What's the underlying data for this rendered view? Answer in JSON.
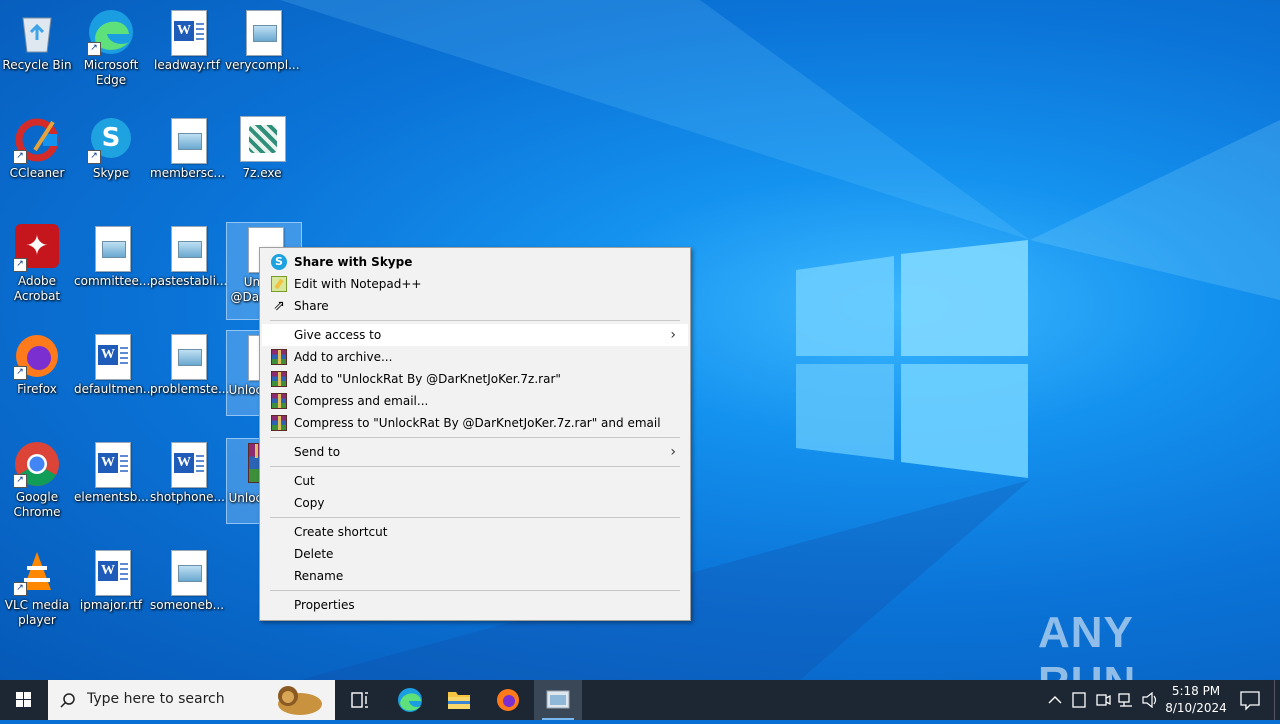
{
  "desktop_icons": [
    {
      "label": "Recycle Bin"
    },
    {
      "label": "Microsoft Edge"
    },
    {
      "label": "leadway.rtf"
    },
    {
      "label": "verycompl..."
    },
    {
      "label": "CCleaner"
    },
    {
      "label": "Skype"
    },
    {
      "label": "membersc..."
    },
    {
      "label": "7z.exe"
    },
    {
      "label": "Adobe Acrobat"
    },
    {
      "label": "committee..."
    },
    {
      "label": "pastestabli..."
    },
    {
      "label": "Unlock @Dark er.7"
    },
    {
      "label": "Firefox"
    },
    {
      "label": "defaultmen..."
    },
    {
      "label": "problemste..."
    },
    {
      "label": "Unloc @Dar"
    },
    {
      "label": "Google Chrome"
    },
    {
      "label": "elementsb..."
    },
    {
      "label": "shotphone..."
    },
    {
      "label": "Unloc @Dar"
    },
    {
      "label": "VLC media player"
    },
    {
      "label": "ipmajor.rtf"
    },
    {
      "label": "someoneb..."
    }
  ],
  "context_menu": {
    "share_skype": "Share with Skype",
    "edit_npp": "Edit with Notepad++",
    "share": "Share",
    "give_access": "Give access to",
    "add_archive": "Add to archive...",
    "add_to_rar": "Add to \"UnlockRat By @DarKnetJoKer.7z.rar\"",
    "compress_email": "Compress and email...",
    "compress_to_rar_email": "Compress to \"UnlockRat By @DarKnetJoKer.7z.rar\" and email",
    "send_to": "Send to",
    "cut": "Cut",
    "copy": "Copy",
    "create_shortcut": "Create shortcut",
    "delete": "Delete",
    "rename": "Rename",
    "properties": "Properties"
  },
  "taskbar": {
    "search_placeholder": "Type here to search",
    "time": "5:18 PM",
    "date": "8/10/2024"
  },
  "watermark": "ANY RUN",
  "colors": {
    "accent": "#0a74da",
    "taskbar": "#1c2733",
    "menu_bg": "#f2f2f2"
  }
}
